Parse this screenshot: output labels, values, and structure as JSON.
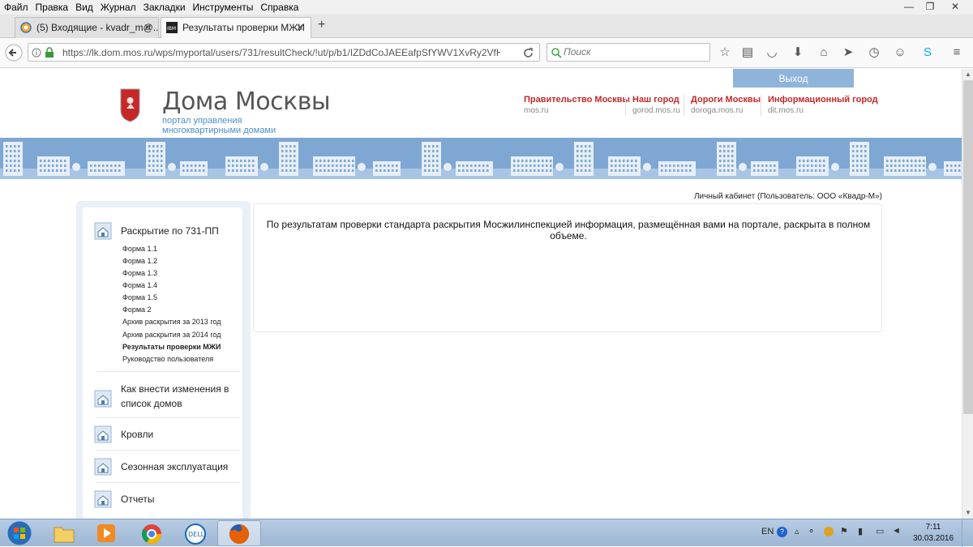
{
  "browser": {
    "menu": [
      "Файл",
      "Правка",
      "Вид",
      "Журнал",
      "Закладки",
      "Инструменты",
      "Справка"
    ],
    "tabs": [
      {
        "label": "(5) Входящие - kvadr_m@...",
        "active": false
      },
      {
        "label": "Результаты проверки МЖИ",
        "active": true
      }
    ],
    "new_tab": "+",
    "url": "https://lk.dom.mos.ru/wps/myportal/users/731/resultCheck/!ut/p/b1/IZDdCoJAEEafpSfYWV1XvRy2VfHfyDJvwosQIt",
    "search_placeholder": "Поиск",
    "window_controls": {
      "minimize": "—",
      "restore": "❐",
      "close": "✕"
    }
  },
  "site": {
    "logout_label": "Выход",
    "brand_title": "Дома Москвы",
    "brand_sub_1": "портал управления",
    "brand_sub_2": "многоквартирными домами",
    "top_links": [
      {
        "title": "Правительство Москвы",
        "sub": "mos.ru"
      },
      {
        "title": "Наш город",
        "sub": "gorod.mos.ru"
      },
      {
        "title": "Дороги Москвы",
        "sub": "doroga.mos.ru"
      },
      {
        "title": "Информационный город",
        "sub": "dit.mos.ru"
      }
    ],
    "cabinet_label": "Личный кабинет (Пользователь: ООО «Квадр-М»)",
    "result_message": "По результатам проверки стандарта раскрытия Мосжилинспекцией информация, размещённая вами на портале, раскрыта в полном объеме."
  },
  "sidebar": {
    "section1_title": "Раскрытие по 731-ПП",
    "section1_links": [
      {
        "label": "Форма 1.1",
        "active": false
      },
      {
        "label": "Форма 1.2",
        "active": false
      },
      {
        "label": "Форма 1.3",
        "active": false
      },
      {
        "label": "Форма 1.4",
        "active": false
      },
      {
        "label": "Форма 1.5",
        "active": false
      },
      {
        "label": "Форма 2",
        "active": false
      },
      {
        "label": "Архив раскрытия за 2013 год",
        "active": false
      },
      {
        "label": "Архив раскрытия за 2014 год",
        "active": false
      },
      {
        "label": "Результаты проверки МЖИ",
        "active": true
      },
      {
        "label": "Руководство пользователя",
        "active": false
      }
    ],
    "section2_title_1": "Как внести изменения в",
    "section2_title_2": "список домов",
    "section3_title": "Кровли",
    "section4_title": "Сезонная эксплуатация",
    "section5_title": "Отчеты"
  },
  "taskbar": {
    "lang": "EN",
    "time": "7:11",
    "date": "30.03.2016"
  },
  "colors": {
    "accent_blue": "#8fb4d9",
    "link_red": "#c62828",
    "brand_blue": "#4a90c8"
  }
}
